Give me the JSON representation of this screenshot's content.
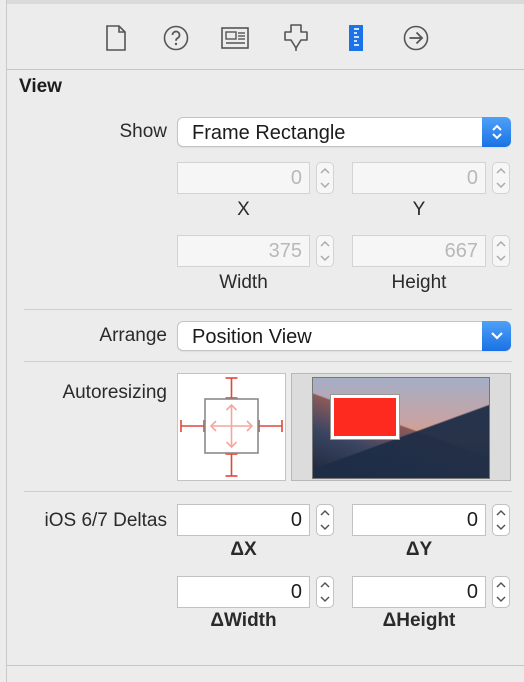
{
  "toolbar": {
    "icons": [
      "file-inspector-icon",
      "quick-help-icon",
      "identity-inspector-icon",
      "attributes-inspector-icon",
      "size-inspector-icon",
      "connections-inspector-icon"
    ],
    "active_color": "#1a73e8"
  },
  "section": {
    "title": "View"
  },
  "show": {
    "label": "Show",
    "value": "Frame Rectangle"
  },
  "frame": {
    "x": {
      "value": "0",
      "label": "X"
    },
    "y": {
      "value": "0",
      "label": "Y"
    },
    "width": {
      "value": "375",
      "label": "Width"
    },
    "height": {
      "value": "667",
      "label": "Height"
    }
  },
  "arrange": {
    "label": "Arrange",
    "value": "Position View"
  },
  "autoresizing": {
    "label": "Autoresizing",
    "accent": "#e2463c",
    "preview_view_color": "#ff2a1f"
  },
  "deltas": {
    "label": "iOS 6/7 Deltas",
    "dx": {
      "value": "0",
      "label": "ΔX"
    },
    "dy": {
      "value": "0",
      "label": "ΔY"
    },
    "dwidth": {
      "value": "0",
      "label": "ΔWidth"
    },
    "dheight": {
      "value": "0",
      "label": "ΔHeight"
    }
  }
}
